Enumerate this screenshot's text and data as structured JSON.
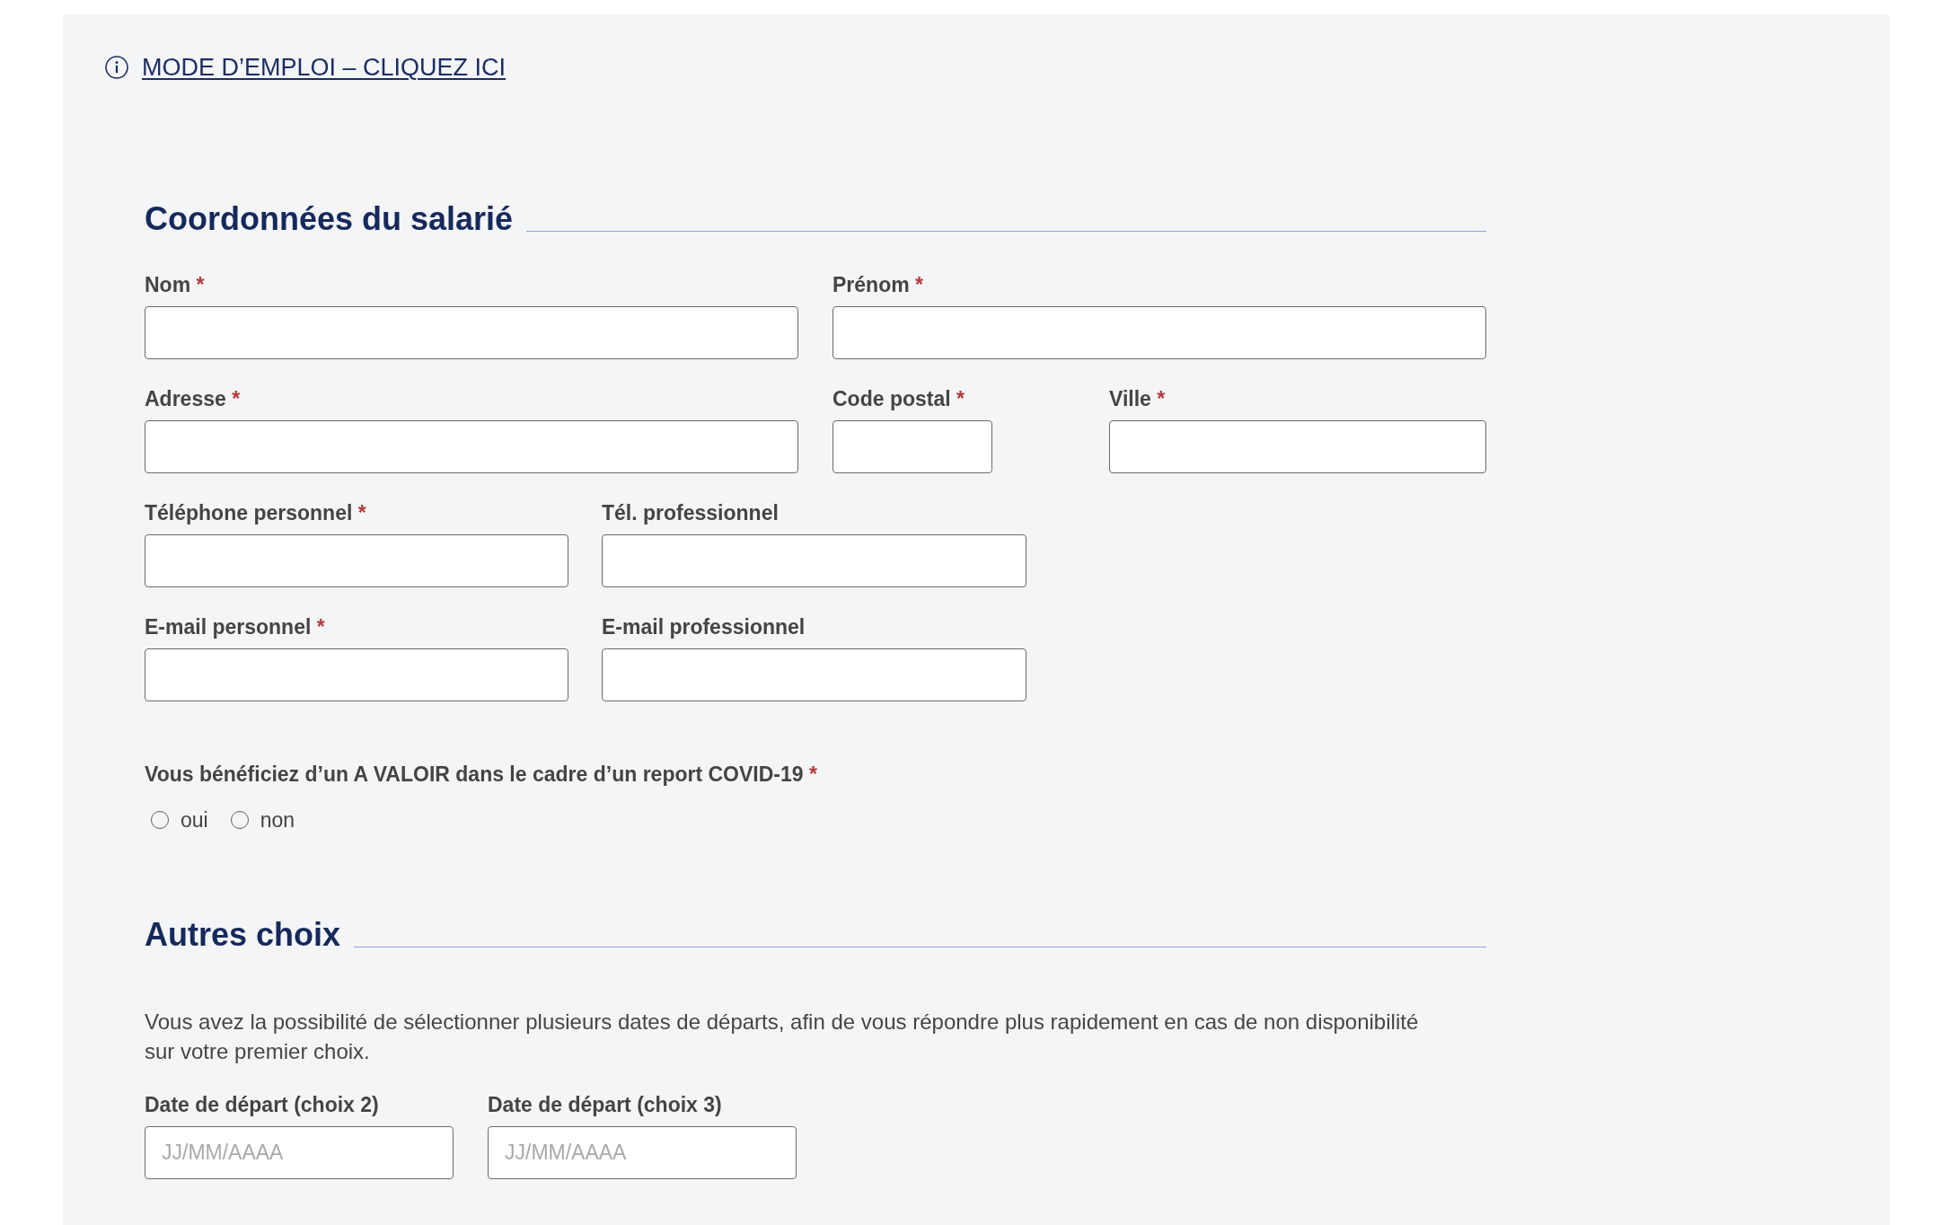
{
  "help_link": {
    "label": "MODE D’EMPLOI – CLIQUEZ ICI"
  },
  "sections": [
    {
      "title": "Coordonnées du salarié",
      "rows": [
        [
          {
            "label": "Nom",
            "required_mark": "*"
          },
          {
            "label": "Prénom",
            "required_mark": "*"
          }
        ],
        [
          {
            "label": "Adresse",
            "required_mark": "*"
          },
          {
            "label": "Code postal",
            "required_mark": "*"
          },
          {
            "label": "Ville",
            "required_mark": "*"
          }
        ],
        [
          {
            "label": "Téléphone personnel",
            "required_mark": "*"
          },
          {
            "label": "Tél. professionnel"
          }
        ],
        [
          {
            "label": "E-mail personnel",
            "required_mark": "*"
          },
          {
            "label": "E-mail professionnel"
          }
        ]
      ],
      "question": {
        "label": "Vous bénéficiez d’un A VALOIR dans le cadre d’un report COVID-19",
        "required_mark": "*",
        "options": [
          {
            "label": "oui",
            "selected": false
          },
          {
            "label": "non",
            "selected": false
          }
        ]
      }
    },
    {
      "title": "Autres choix",
      "intro": "Vous avez la possibilité de sélectionner plusieurs dates de départs, afin de vous répondre plus rapidement en cas de non disponibilité sur votre premier choix.",
      "rows": [
        [
          {
            "label": "Date de départ (choix 2)",
            "placeholder": "JJ/MM/AAAA"
          },
          {
            "label": "Date de départ (choix 3)",
            "placeholder": "JJ/MM/AAAA"
          }
        ]
      ]
    }
  ]
}
